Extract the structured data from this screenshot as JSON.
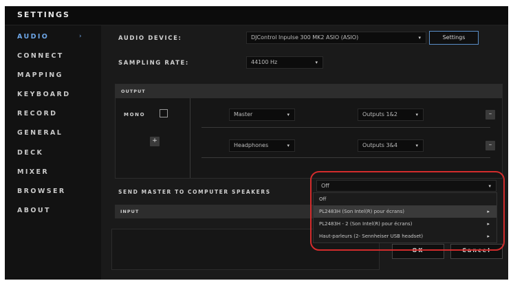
{
  "window": {
    "title": "SETTINGS"
  },
  "sidebar": {
    "items": [
      {
        "label": "AUDIO",
        "active": true
      },
      {
        "label": "CONNECT"
      },
      {
        "label": "MAPPING"
      },
      {
        "label": "KEYBOARD"
      },
      {
        "label": "RECORD"
      },
      {
        "label": "GENERAL"
      },
      {
        "label": "DECK"
      },
      {
        "label": "MIXER"
      },
      {
        "label": "BROWSER"
      },
      {
        "label": "ABOUT"
      }
    ],
    "active_arrow": "›"
  },
  "audio": {
    "device_label": "AUDIO DEVICE:",
    "device_value": "DJControl Inpulse 300 MK2 ASIO (ASIO)",
    "settings_button": "Settings",
    "sampling_label": "SAMPLING RATE:",
    "sampling_value": "44100 Hz",
    "output": {
      "header": "OUTPUT",
      "mono_label": "MONO",
      "add_symbol": "+",
      "rows": [
        {
          "source": "Master",
          "dest": "Outputs 1&2",
          "remove": "–"
        },
        {
          "source": "Headphones",
          "dest": "Outputs 3&4",
          "remove": "–"
        }
      ]
    },
    "send_master_label": "SEND MASTER TO COMPUTER SPEAKERS",
    "send_master_value": "Off",
    "input": {
      "header": "INPUT"
    },
    "dropdown_options": [
      {
        "label": "Off",
        "submenu": false
      },
      {
        "label": "PL2483H (Son Intel(R) pour écrans)",
        "submenu": true
      },
      {
        "label": "PL2483H - 2 (Son Intel(R) pour écrans)",
        "submenu": true
      },
      {
        "label": "Haut-parleurs (2- Sennheiser USB headset)",
        "submenu": true
      }
    ],
    "ok_button": "OK",
    "cancel_button": "Cancel"
  },
  "icons": {
    "dropdown": "▾",
    "submenu": "▸"
  },
  "colors": {
    "accent": "#6ea7e8",
    "highlight": "#d42c2c",
    "background": "#1a1a1a"
  }
}
